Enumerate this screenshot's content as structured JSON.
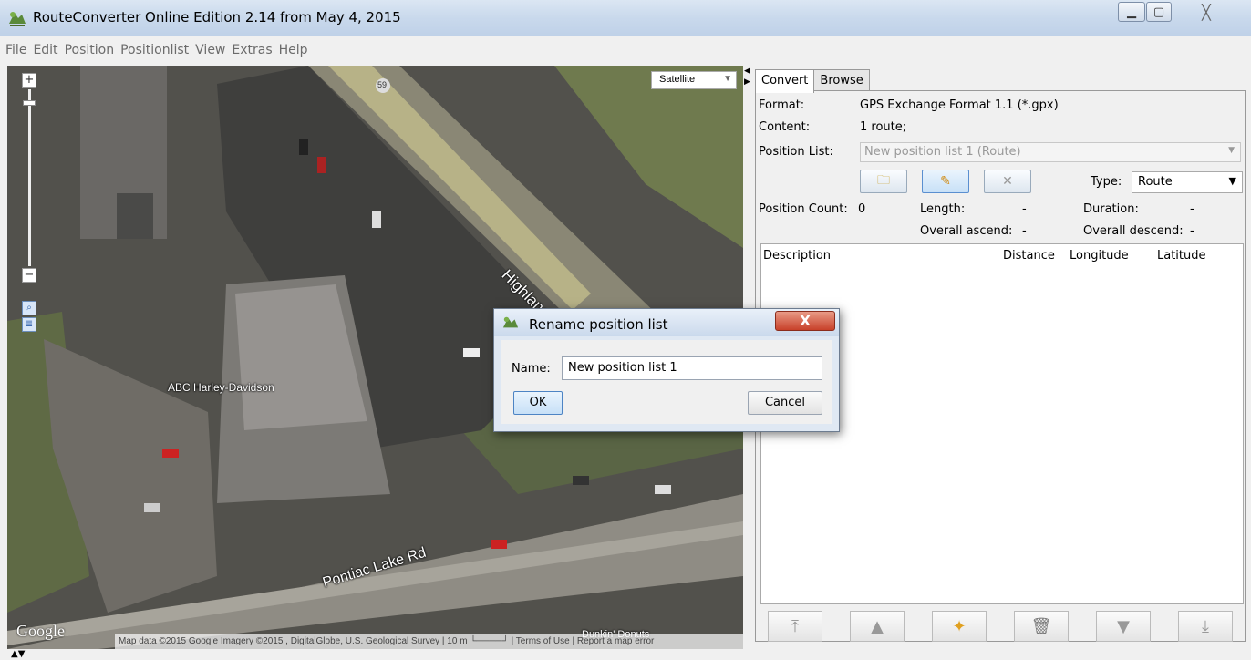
{
  "window": {
    "title": "RouteConverter Online Edition 2.14 from May 4, 2015",
    "minimize_icon": "minimize-icon",
    "maximize_icon": "maximize-icon",
    "close_icon": "close-icon"
  },
  "menu": [
    "File",
    "Edit",
    "Position",
    "Positionlist",
    "View",
    "Extras",
    "Help"
  ],
  "map": {
    "zoom_in": "+",
    "zoom_out": "−",
    "map_type": "Satellite",
    "labels": {
      "road_59": "59",
      "highland": "Highland Rd",
      "pontiac": "Pontiac Lake Rd",
      "harley": "ABC Harley-Davidson",
      "dunkin": "Dunkin' Donuts"
    },
    "google": "Google",
    "attribution": "Map data ©2015 Google Imagery ©2015 , DigitalGlobe, U.S. Geological Survey  |  10 m └────┘  |  Terms of Use  |  Report a map error"
  },
  "tabs": [
    "Convert",
    "Browse"
  ],
  "convert": {
    "format_label": "Format:",
    "format_value": "GPS Exchange Format 1.1 (*.gpx)",
    "content_label": "Content:",
    "content_value": "1 route;",
    "position_list_label": "Position List:",
    "position_list_value": "New position list 1 (Route)",
    "type_label": "Type:",
    "type_value": "Route",
    "position_count_label": "Position Count:",
    "position_count_value": "0",
    "length_label": "Length:",
    "length_value": "-",
    "duration_label": "Duration:",
    "duration_value": "-",
    "ascend_label": "Overall ascend:",
    "ascend_value": "-",
    "descend_label": "Overall descend:",
    "descend_value": "-"
  },
  "table": {
    "columns": [
      "Description",
      "Distance",
      "Longitude",
      "Latitude"
    ]
  },
  "dialog": {
    "title": "Rename position list",
    "close": "X",
    "name_label": "Name:",
    "name_value": "New position list 1",
    "ok": "OK",
    "cancel": "Cancel"
  }
}
